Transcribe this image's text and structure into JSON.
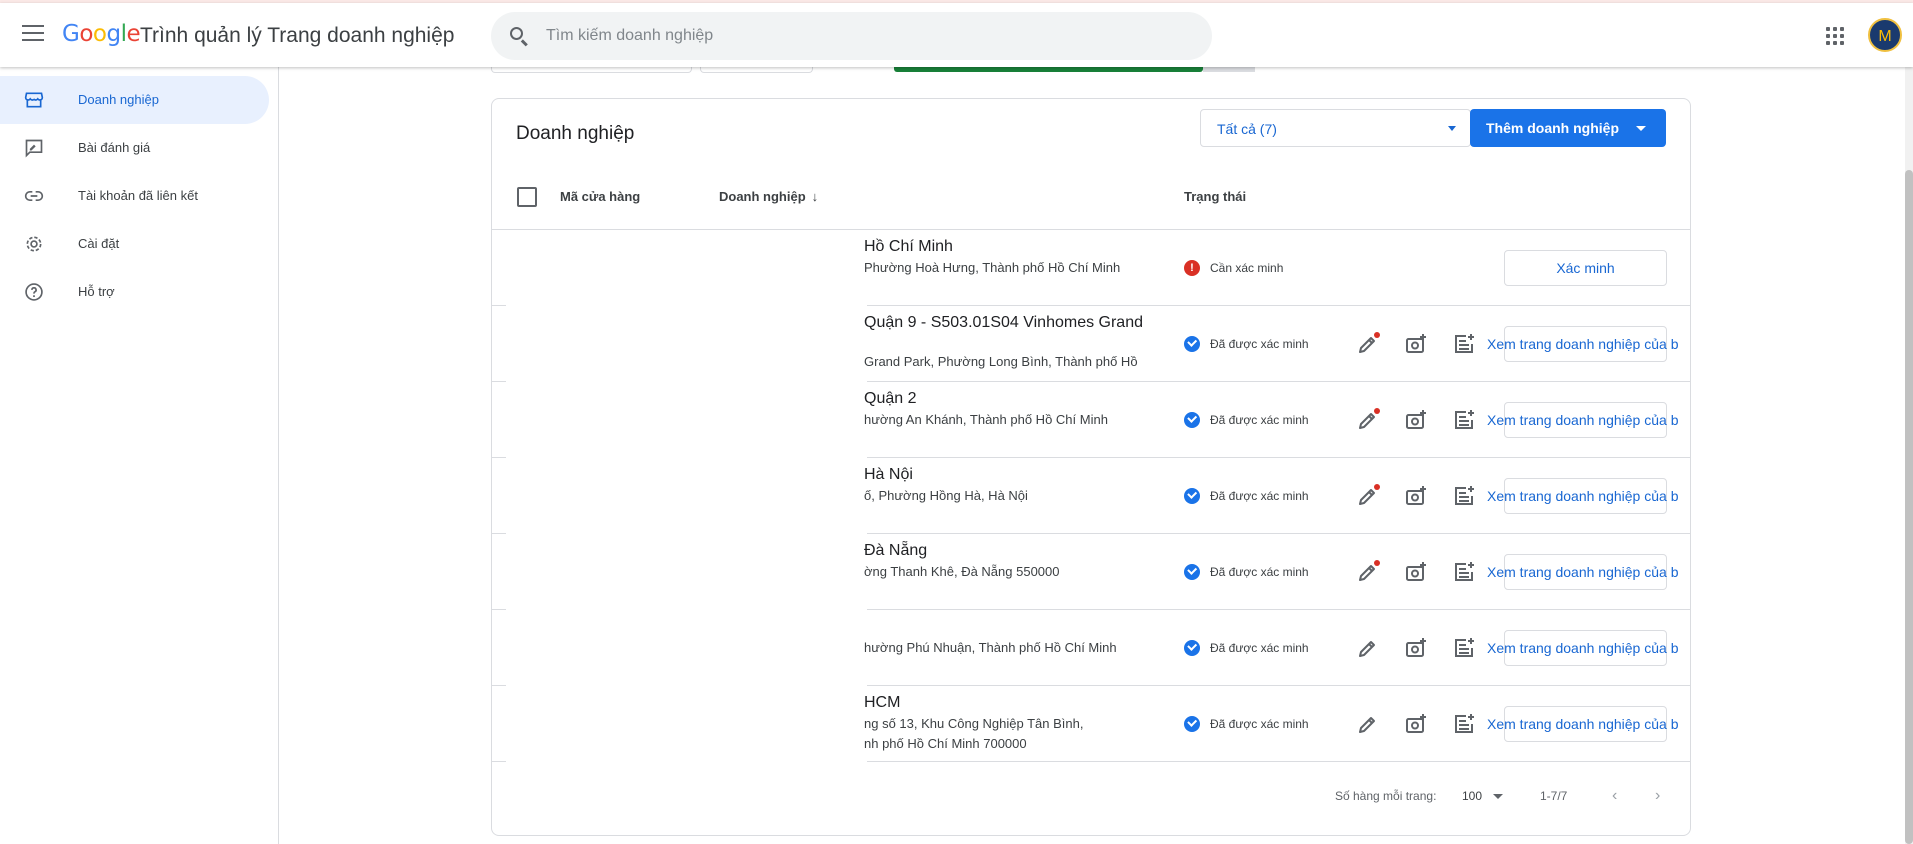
{
  "app": {
    "logo": "Google",
    "title": "Trình quản lý Trang doanh nghiệp",
    "avatar_letter": "M"
  },
  "search": {
    "placeholder": "Tìm kiếm doanh nghiệp"
  },
  "sidebar": {
    "items": [
      {
        "label": "Doanh nghiệp",
        "icon": "storefront-icon",
        "active": true
      },
      {
        "label": "Bài đánh giá",
        "icon": "rate-review-icon"
      },
      {
        "label": "Tài khoản đã liên kết",
        "icon": "link-icon"
      },
      {
        "label": "Cài đặt",
        "icon": "gear-icon"
      },
      {
        "label": "Hỗ trợ",
        "icon": "help-icon"
      }
    ]
  },
  "card": {
    "title": "Doanh nghiệp",
    "filter_value": "Tất cả (7)",
    "add_button": "Thêm doanh nghiệp"
  },
  "table": {
    "headers": {
      "store_code": "Mã cửa hàng",
      "business": "Doanh nghiệp",
      "status": "Trạng thái"
    },
    "sort_icon": "↓",
    "rows": [
      {
        "name": "Hồ Chí Minh",
        "addr1": "Phường Hoà Hưng, Thành phố Hồ Chí Minh",
        "addr2": "",
        "status": "Cần xác minh",
        "verified": false,
        "action": "Xác minh"
      },
      {
        "name": "Quận 9 - S503.01S04 Vinhomes Grand",
        "addr1": "Grand Park, Phường Long Bình, Thành phố Hồ",
        "addr2": "",
        "status": "Đã được xác minh",
        "verified": true,
        "action": "Xem trang doanh nghiệp của b"
      },
      {
        "name": "Quận 2",
        "addr1": "hường An Khánh, Thành phố Hồ Chí Minh",
        "addr2": "",
        "status": "Đã được xác minh",
        "verified": true,
        "action": "Xem trang doanh nghiệp của b"
      },
      {
        "name": "Hà Nội",
        "addr1": "ố, Phường Hồng Hà, Hà Nội",
        "addr2": "",
        "status": "Đã được xác minh",
        "verified": true,
        "action": "Xem trang doanh nghiệp của b"
      },
      {
        "name": "Đà Nẵng",
        "addr1": "ờng Thanh Khê, Đà Nẵng 550000",
        "addr2": "",
        "status": "Đã được xác minh",
        "verified": true,
        "action": "Xem trang doanh nghiệp của b"
      },
      {
        "name": "",
        "addr1": "hường Phú Nhuận, Thành phố Hồ Chí Minh",
        "addr2": "",
        "status": "Đã được xác minh",
        "verified": true,
        "action": "Xem trang doanh nghiệp của b"
      },
      {
        "name": "HCM",
        "addr1": "ng số 13, Khu Công Nghiệp Tân Bình,",
        "addr2": "nh phố Hồ Chí Minh 700000",
        "status": "Đã được xác minh",
        "verified": true,
        "action": "Xem trang doanh nghiệp của b"
      }
    ]
  },
  "pagination": {
    "rows_per_page_label": "Số hàng mỗi trang:",
    "rows_per_page": "100",
    "range": "1-7/7"
  },
  "colors": {
    "accent": "#1a73e8",
    "verified": "#1a73e8",
    "warning": "#d93025",
    "active_nav_bg": "#e8f0fe"
  }
}
